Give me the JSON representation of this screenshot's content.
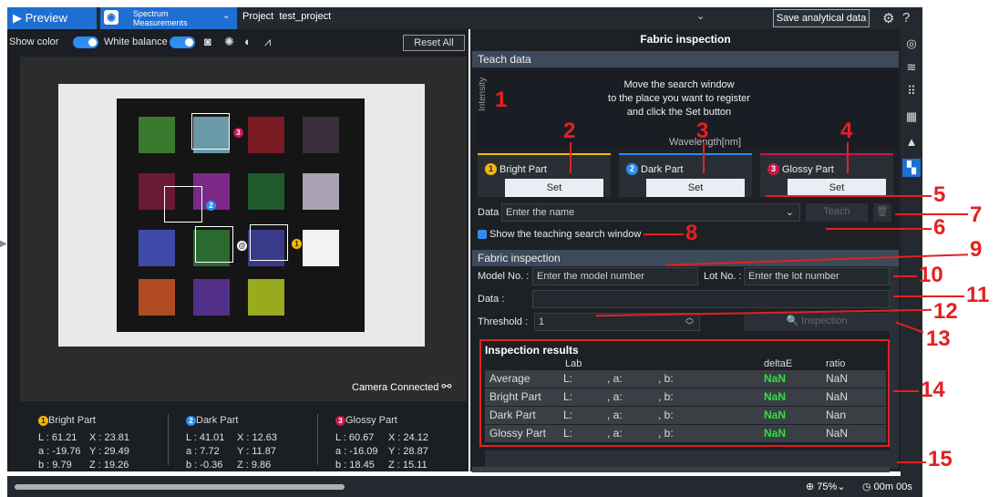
{
  "header": {
    "preview_label": "Preview",
    "spectrum_label_1": "Spectrum",
    "spectrum_label_2": "Measurements",
    "project_label": "Project",
    "project_name": "test_project",
    "save_label": "Save analytical data"
  },
  "toolbar": {
    "show_color": "Show color",
    "white_balance": "White balance",
    "reset_all": "Reset All"
  },
  "camera_status": "Camera Connected",
  "readouts": [
    {
      "name": "Bright Part",
      "num": "1",
      "L": "L : 61.21",
      "a": "a : -19.76",
      "b": "b : 9.79",
      "X": "X : 23.81",
      "Y": "Y : 29.49",
      "Z": "Z : 19.26"
    },
    {
      "name": "Dark Part",
      "num": "2",
      "L": "L : 41.01",
      "a": "a : 7.72",
      "b": "b : -0.36",
      "X": "X : 12.63",
      "Y": "Y : 11.87",
      "Z": "Z : 9.86"
    },
    {
      "name": "Glossy Part",
      "num": "3",
      "L": "L : 60.67",
      "a": "a : -16.09",
      "b": "b : 18.45",
      "X": "X : 24.12",
      "Y": "Y : 28.87",
      "Z": "Z : 15.11"
    }
  ],
  "panel": {
    "title": "Fabric inspection",
    "teach_header": "Teach data",
    "graph_msg_1": "Move the search window",
    "graph_msg_2": "to the place you want to register",
    "graph_msg_3": "and click the Set button",
    "y_axis": "Intensity",
    "x_axis": "Wavelength[nm]",
    "set_label": "Set",
    "parts": [
      {
        "num": "1",
        "label": "Bright Part",
        "color": "#f5b800"
      },
      {
        "num": "2",
        "label": "Dark Part",
        "color": "#2f8cf0"
      },
      {
        "num": "3",
        "label": "Glossy Part",
        "color": "#c8184a"
      }
    ],
    "data_label": "Data",
    "data_placeholder": "Enter the name",
    "teach_btn": "Teach",
    "show_window": "Show the teaching search window",
    "inspect_header": "Fabric inspection",
    "model_label": "Model No. :",
    "model_placeholder": "Enter the model number",
    "lot_label": "Lot No. :",
    "lot_placeholder": "Enter the lot number",
    "data2_label": "Data :",
    "threshold_label": "Threshold :",
    "threshold_value": "1",
    "inspection_btn": "Inspection"
  },
  "results": {
    "title": "Inspection results",
    "col_lab": "Lab",
    "col_delta": "deltaE",
    "col_ratio": "ratio",
    "rows": [
      {
        "name": "Average",
        "L": "L:",
        "a": ", a:",
        "b": ", b:",
        "delta": "NaN",
        "ratio": "NaN"
      },
      {
        "name": "Bright Part",
        "L": "L:",
        "a": ", a:",
        "b": ", b:",
        "delta": "NaN",
        "ratio": "NaN"
      },
      {
        "name": "Dark Part",
        "L": "L:",
        "a": ", a:",
        "b": ", b:",
        "delta": "NaN",
        "ratio": "Nan"
      },
      {
        "name": "Glossy Part",
        "L": "L:",
        "a": ", a:",
        "b": ", b:",
        "delta": "NaN",
        "ratio": "NaN"
      }
    ]
  },
  "status": {
    "zoom": "75%",
    "timer": "00m 00s"
  },
  "callouts": [
    "1",
    "2",
    "3",
    "4",
    "5",
    "6",
    "7",
    "8",
    "9",
    "10",
    "11",
    "12",
    "13",
    "14",
    "15"
  ],
  "patch_colors": [
    "#3a7a2e",
    "#6a9aa8",
    "#7a1a22",
    "#3a2e3c",
    "#6a1a36",
    "#7a2a86",
    "#1e5a2a",
    "#a8a2b4",
    "#3e4aa8",
    "#2a6a30",
    "#3a3a8a",
    "#f2f2f2",
    "#b04a20",
    "#52308a",
    "#9aaa1e"
  ]
}
